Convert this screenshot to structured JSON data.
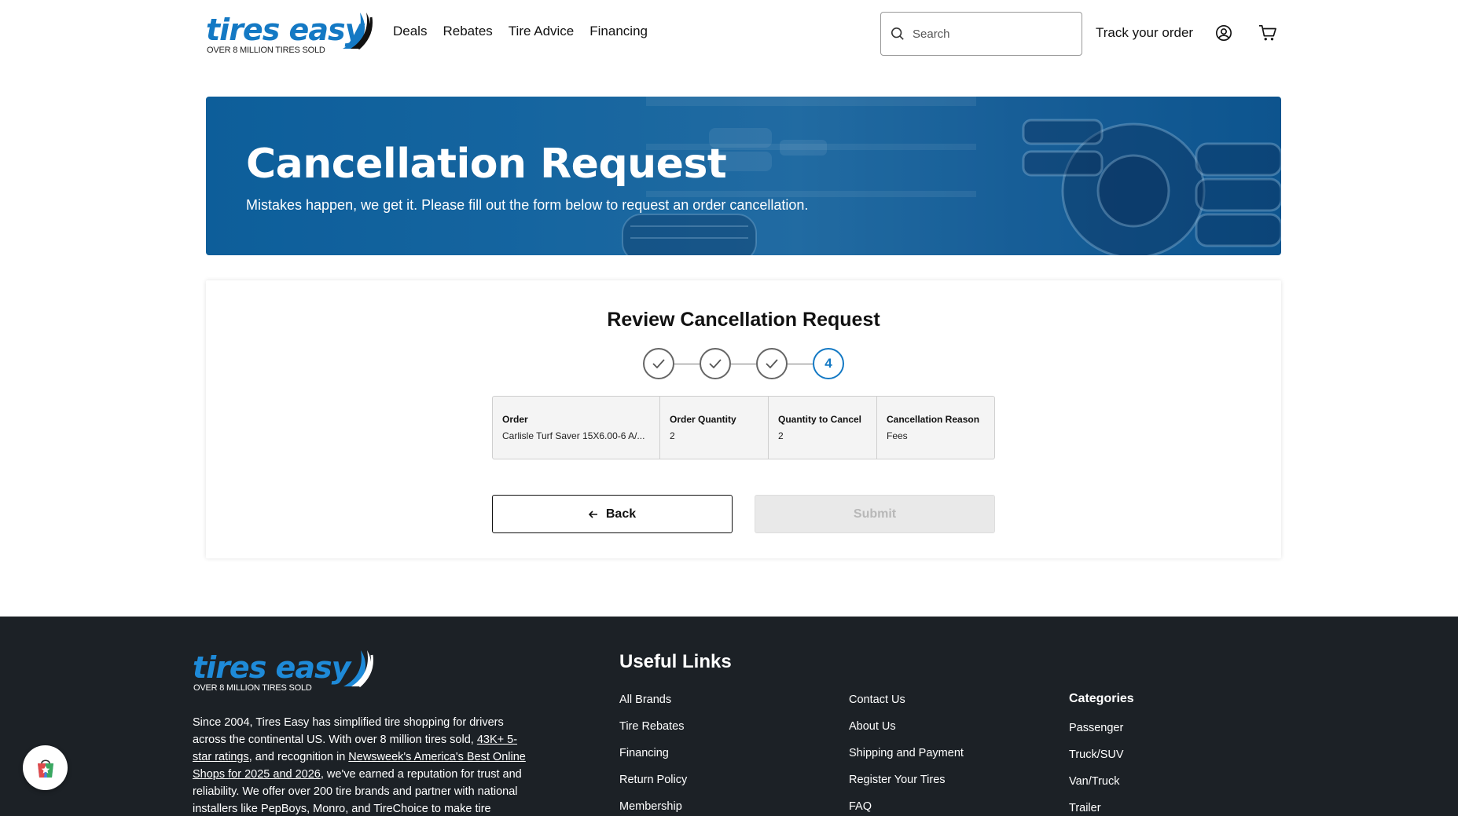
{
  "brand": {
    "logo_text": "tires easy",
    "logo_sub": "OVER 8 MILLION TIRES SOLD",
    "primary_color": "#1479c4"
  },
  "nav": {
    "items": [
      "Deals",
      "Rebates",
      "Tire Advice",
      "Financing"
    ]
  },
  "search": {
    "placeholder": "Search"
  },
  "header": {
    "track_order": "Track your order"
  },
  "hero": {
    "title": "Cancellation Request",
    "subtitle": "Mistakes happen, we get it. Please fill out the form below to request an order cancellation."
  },
  "review": {
    "title": "Review Cancellation Request",
    "current_step": "4",
    "columns": [
      {
        "head": "Order",
        "value": "Carlisle Turf Saver 15X6.00-6 A/..."
      },
      {
        "head": "Order Quantity",
        "value": "2"
      },
      {
        "head": "Quantity to Cancel",
        "value": "2"
      },
      {
        "head": "Cancellation Reason",
        "value": "Fees"
      }
    ],
    "back_label": "Back",
    "submit_label": "Submit"
  },
  "footer": {
    "about_1": "Since 2004, Tires Easy has simplified tire shopping for drivers across the continental US. With over 8 million tires sold, ",
    "about_link_1": "43K+ 5-star ratings",
    "about_2": ", and recognition in ",
    "about_link_2": "Newsweek's America's Best Online Shops for 2025 and 2026",
    "about_3": ", we've earned a reputation for trust and reliability. We offer over 200 tire brands and partner with national installers like PepBoys, Monro, and TireChoice to make tire",
    "useful_links_title": "Useful Links",
    "links_col1": [
      "All Brands",
      "Tire Rebates",
      "Financing",
      "Return Policy",
      "Membership"
    ],
    "links_col2": [
      "Contact Us",
      "About Us",
      "Shipping and Payment",
      "Register Your Tires",
      "FAQ"
    ],
    "categories_title": "Categories",
    "categories": [
      "Passenger",
      "Truck/SUV",
      "Van/Truck",
      "Trailer"
    ]
  }
}
